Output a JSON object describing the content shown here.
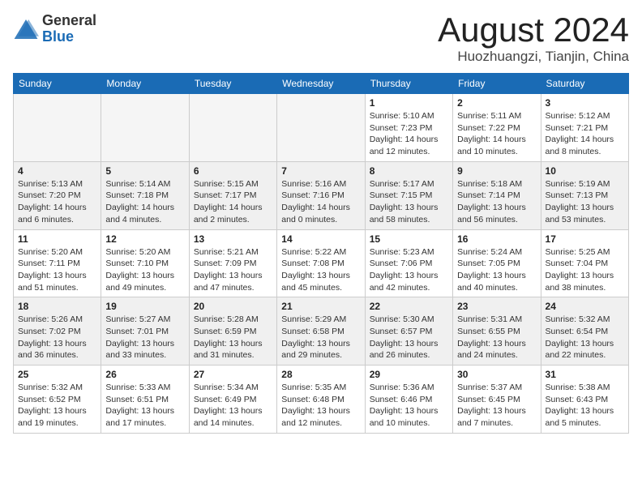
{
  "header": {
    "logo_general": "General",
    "logo_blue": "Blue",
    "month_title": "August 2024",
    "location": "Huozhuangzi, Tianjin, China"
  },
  "calendar": {
    "days_of_week": [
      "Sunday",
      "Monday",
      "Tuesday",
      "Wednesday",
      "Thursday",
      "Friday",
      "Saturday"
    ],
    "weeks": [
      {
        "days": [
          {
            "num": "",
            "empty": true
          },
          {
            "num": "",
            "empty": true
          },
          {
            "num": "",
            "empty": true
          },
          {
            "num": "",
            "empty": true
          },
          {
            "num": "1",
            "sunrise": "5:10 AM",
            "sunset": "7:23 PM",
            "daylight": "14 hours and 12 minutes."
          },
          {
            "num": "2",
            "sunrise": "5:11 AM",
            "sunset": "7:22 PM",
            "daylight": "14 hours and 10 minutes."
          },
          {
            "num": "3",
            "sunrise": "5:12 AM",
            "sunset": "7:21 PM",
            "daylight": "14 hours and 8 minutes."
          }
        ]
      },
      {
        "days": [
          {
            "num": "4",
            "sunrise": "5:13 AM",
            "sunset": "7:20 PM",
            "daylight": "14 hours and 6 minutes."
          },
          {
            "num": "5",
            "sunrise": "5:14 AM",
            "sunset": "7:18 PM",
            "daylight": "14 hours and 4 minutes."
          },
          {
            "num": "6",
            "sunrise": "5:15 AM",
            "sunset": "7:17 PM",
            "daylight": "14 hours and 2 minutes."
          },
          {
            "num": "7",
            "sunrise": "5:16 AM",
            "sunset": "7:16 PM",
            "daylight": "14 hours and 0 minutes."
          },
          {
            "num": "8",
            "sunrise": "5:17 AM",
            "sunset": "7:15 PM",
            "daylight": "13 hours and 58 minutes."
          },
          {
            "num": "9",
            "sunrise": "5:18 AM",
            "sunset": "7:14 PM",
            "daylight": "13 hours and 56 minutes."
          },
          {
            "num": "10",
            "sunrise": "5:19 AM",
            "sunset": "7:13 PM",
            "daylight": "13 hours and 53 minutes."
          }
        ]
      },
      {
        "days": [
          {
            "num": "11",
            "sunrise": "5:20 AM",
            "sunset": "7:11 PM",
            "daylight": "13 hours and 51 minutes."
          },
          {
            "num": "12",
            "sunrise": "5:20 AM",
            "sunset": "7:10 PM",
            "daylight": "13 hours and 49 minutes."
          },
          {
            "num": "13",
            "sunrise": "5:21 AM",
            "sunset": "7:09 PM",
            "daylight": "13 hours and 47 minutes."
          },
          {
            "num": "14",
            "sunrise": "5:22 AM",
            "sunset": "7:08 PM",
            "daylight": "13 hours and 45 minutes."
          },
          {
            "num": "15",
            "sunrise": "5:23 AM",
            "sunset": "7:06 PM",
            "daylight": "13 hours and 42 minutes."
          },
          {
            "num": "16",
            "sunrise": "5:24 AM",
            "sunset": "7:05 PM",
            "daylight": "13 hours and 40 minutes."
          },
          {
            "num": "17",
            "sunrise": "5:25 AM",
            "sunset": "7:04 PM",
            "daylight": "13 hours and 38 minutes."
          }
        ]
      },
      {
        "days": [
          {
            "num": "18",
            "sunrise": "5:26 AM",
            "sunset": "7:02 PM",
            "daylight": "13 hours and 36 minutes."
          },
          {
            "num": "19",
            "sunrise": "5:27 AM",
            "sunset": "7:01 PM",
            "daylight": "13 hours and 33 minutes."
          },
          {
            "num": "20",
            "sunrise": "5:28 AM",
            "sunset": "6:59 PM",
            "daylight": "13 hours and 31 minutes."
          },
          {
            "num": "21",
            "sunrise": "5:29 AM",
            "sunset": "6:58 PM",
            "daylight": "13 hours and 29 minutes."
          },
          {
            "num": "22",
            "sunrise": "5:30 AM",
            "sunset": "6:57 PM",
            "daylight": "13 hours and 26 minutes."
          },
          {
            "num": "23",
            "sunrise": "5:31 AM",
            "sunset": "6:55 PM",
            "daylight": "13 hours and 24 minutes."
          },
          {
            "num": "24",
            "sunrise": "5:32 AM",
            "sunset": "6:54 PM",
            "daylight": "13 hours and 22 minutes."
          }
        ]
      },
      {
        "days": [
          {
            "num": "25",
            "sunrise": "5:32 AM",
            "sunset": "6:52 PM",
            "daylight": "13 hours and 19 minutes."
          },
          {
            "num": "26",
            "sunrise": "5:33 AM",
            "sunset": "6:51 PM",
            "daylight": "13 hours and 17 minutes."
          },
          {
            "num": "27",
            "sunrise": "5:34 AM",
            "sunset": "6:49 PM",
            "daylight": "13 hours and 14 minutes."
          },
          {
            "num": "28",
            "sunrise": "5:35 AM",
            "sunset": "6:48 PM",
            "daylight": "13 hours and 12 minutes."
          },
          {
            "num": "29",
            "sunrise": "5:36 AM",
            "sunset": "6:46 PM",
            "daylight": "13 hours and 10 minutes."
          },
          {
            "num": "30",
            "sunrise": "5:37 AM",
            "sunset": "6:45 PM",
            "daylight": "13 hours and 7 minutes."
          },
          {
            "num": "31",
            "sunrise": "5:38 AM",
            "sunset": "6:43 PM",
            "daylight": "13 hours and 5 minutes."
          }
        ]
      }
    ]
  }
}
